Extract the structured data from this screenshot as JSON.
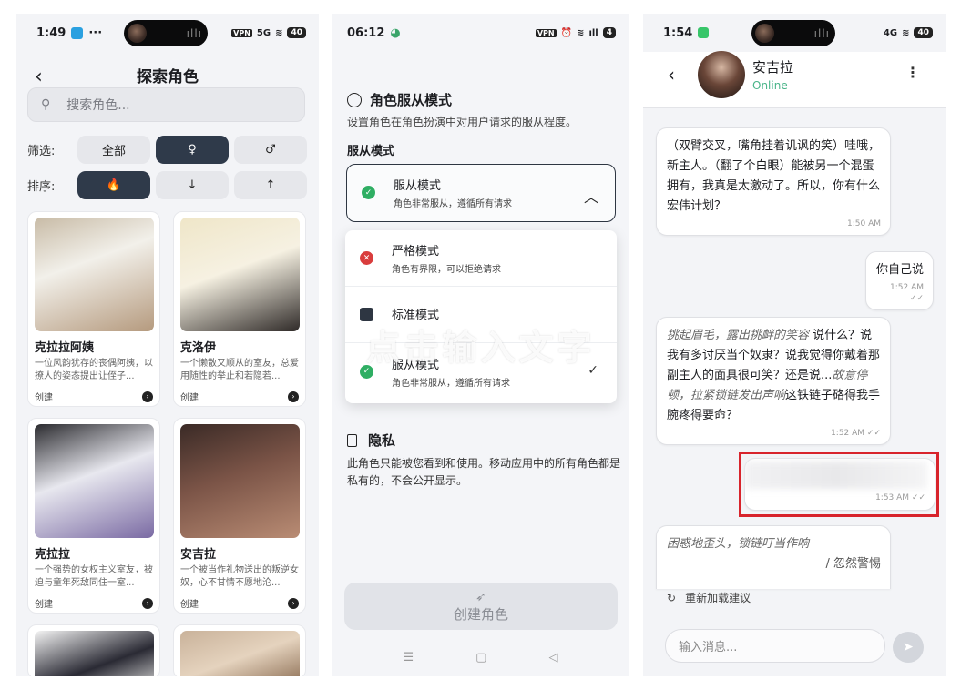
{
  "panel1": {
    "status": {
      "time": "1:49",
      "extra": "···",
      "vpn": "VPN",
      "net": "5G",
      "battery": "40"
    },
    "title": "探索角色",
    "search": {
      "placeholder": "搜索角色..."
    },
    "filter": {
      "label": "筛选:",
      "options": [
        "全部",
        "♀",
        "♂"
      ],
      "selected": "♀"
    },
    "sort": {
      "label": "排序:",
      "options": [
        "🔥",
        "↓",
        "↑"
      ],
      "selected": "🔥"
    },
    "cards": [
      {
        "name": "克拉拉阿姨",
        "desc": "一位风韵犹存的丧偶阿姨，以撩人的姿态提出让侄子...",
        "action": "创建"
      },
      {
        "name": "克洛伊",
        "desc": "一个懒散又顺从的室友，总爱用随性的举止和若隐若...",
        "action": "创建"
      },
      {
        "name": "克拉拉",
        "desc": "一个强势的女权主义室友，被迫与童年死敌同住一室...",
        "action": "创建"
      },
      {
        "name": "安吉拉",
        "desc": "一个被当作礼物送出的叛逆女奴，心不甘情不愿地沦...",
        "action": "创建"
      }
    ]
  },
  "panel2": {
    "status": {
      "time": "06:12",
      "vpn": "VPN",
      "battery": "4"
    },
    "section_title": "角色服从模式",
    "section_sub": "设置角色在角色扮演中对用户请求的服从程度。",
    "field_label": "服从模式",
    "selected": {
      "title": "服从模式",
      "sub": "角色非常服从，遵循所有请求"
    },
    "options": [
      {
        "title": "严格模式",
        "sub": "角色有界限，可以拒绝请求"
      },
      {
        "title": "标准模式",
        "sub": ""
      },
      {
        "title": "服从模式",
        "sub": "角色非常服从，遵循所有请求"
      }
    ],
    "watermark": "点击输入文字",
    "privacy_title": "隐私",
    "privacy_text": "此角色只能被您看到和使用。移动应用中的所有角色都是私有的，不会公开显示。",
    "create_button": "创建角色",
    "nav": [
      "☰",
      "▢",
      "◁"
    ]
  },
  "panel3": {
    "status": {
      "time": "1:54",
      "net": "4G",
      "battery": "40"
    },
    "name": "安吉拉",
    "presence": "Online",
    "messages": [
      {
        "text": "（双臂交叉，嘴角挂着讥讽的笑）哇哦，新主人。（翻了个白眼）能被另一个混蛋拥有，我真是太激动了。所以，你有什么宏伟计划？",
        "time": "1:50 AM"
      },
      {
        "text": "你自己说",
        "time": "1:52 AM ✓✓"
      },
      {
        "italic": "挑起眉毛，露出挑衅的笑容",
        "text": "说什么？说我有多讨厌当个奴隶？说我觉得你戴着那副主人的面具很可笑？还是说...",
        "italic2": "故意停顿，拉紧锁链发出声响",
        "text2": "这铁链子硌得我手腕疼得要命？",
        "time": "1:52 AM ✓✓"
      },
      {
        "text": "",
        "time": "1:53 AM ✓✓"
      },
      {
        "italic": "困惑地歪头，锁链叮当作响",
        "text": "",
        "time": ""
      }
    ],
    "partial_trailing": "/ 忽然警惕",
    "reload": "重新加载建议",
    "input_placeholder": "输入消息..."
  }
}
